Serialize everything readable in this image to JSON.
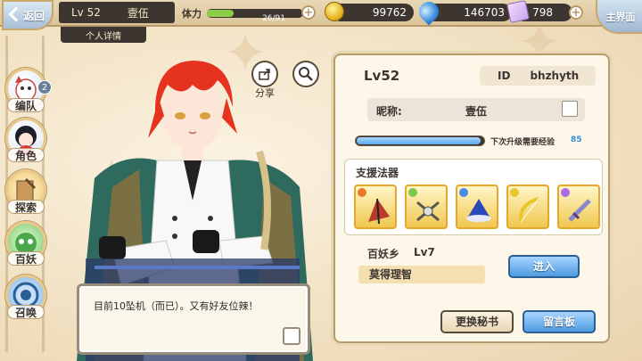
{
  "topbar": {
    "back_label": "返回",
    "player_level": "Lv 52",
    "player_name": "壹伍",
    "detail_tab": "个人详情",
    "stamina_label": "体力",
    "stamina_value": "26/91",
    "stamina_fraction": 0.286,
    "gold": "99762",
    "drops": "146703",
    "cards": "798",
    "main_label": "主界面"
  },
  "nav": {
    "items": [
      {
        "label": "编队",
        "icon": "team-icon",
        "badge": "2"
      },
      {
        "label": "角色",
        "icon": "character-icon"
      },
      {
        "label": "探索",
        "icon": "explore-icon"
      },
      {
        "label": "百妖",
        "icon": "monster-icon"
      },
      {
        "label": "召唤",
        "icon": "summon-icon"
      }
    ]
  },
  "actions": {
    "share_label": "分享"
  },
  "dialog": {
    "text": "目前10坠机（而已）。又有好友位辣！"
  },
  "profile": {
    "level": "Lv52",
    "id_key": "ID",
    "id_value": "bhzhyth",
    "nick_key": "昵称:",
    "nick_value": "壹伍",
    "exp_label": "下次升级需要经验",
    "exp_value": "85",
    "exp_fraction": 0.98,
    "support_title": "支援法器",
    "support_items": [
      {
        "name": "fan-weapon-icon",
        "gem": "#e87a2a"
      },
      {
        "name": "crossbow-weapon-icon",
        "gem": "#7ac84a"
      },
      {
        "name": "hat-weapon-icon",
        "gem": "#4a8ae8"
      },
      {
        "name": "bow-weapon-icon",
        "gem": "#e8c82a"
      },
      {
        "name": "sword-weapon-icon",
        "gem": "#a86ae8"
      }
    ],
    "village": "百妖乡",
    "village_level": "Lv7",
    "village_name": "莫得理智",
    "enter_label": "进入",
    "change_secretary_label": "更换秘书",
    "message_board_label": "留言板"
  }
}
